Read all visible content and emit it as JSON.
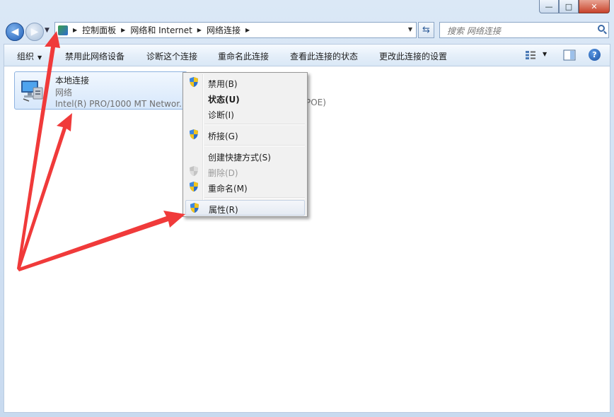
{
  "window": {
    "minimize_glyph": "—",
    "maximize_glyph": "□",
    "close_glyph": "✕"
  },
  "address": {
    "crumbs": [
      "控制面板",
      "网络和 Internet",
      "网络连接"
    ],
    "search_placeholder": "搜索 网络连接"
  },
  "toolbar": {
    "organize": "组织",
    "disable": "禁用此网络设备",
    "diagnose": "诊断这个连接",
    "rename": "重命名此连接",
    "view_status": "查看此连接的状态",
    "change_settings": "更改此连接的设置"
  },
  "connection": {
    "name": "本地连接",
    "type": "网络",
    "device": "Intel(R) PRO/1000 MT Networ...",
    "partial_text": "POE)"
  },
  "context_menu": {
    "items": [
      {
        "label": "禁用(B)",
        "icon": "shield-icon"
      },
      {
        "label": "状态(U)",
        "icon": "none",
        "bold": true
      },
      {
        "label": "诊断(I)",
        "icon": "none"
      },
      {
        "label": "桥接(G)",
        "icon": "shield-icon"
      },
      {
        "label": "创建快捷方式(S)",
        "icon": "none"
      },
      {
        "label": "删除(D)",
        "icon": "shield-icon",
        "disabled": true
      },
      {
        "label": "重命名(M)",
        "icon": "shield-icon"
      },
      {
        "label": "属性(R)",
        "icon": "shield-icon",
        "highlighted": true
      }
    ]
  },
  "colors": {
    "arrow": "#f03a3a",
    "selection": "#d6e7fb",
    "menu_bg": "#f1f1f1"
  }
}
